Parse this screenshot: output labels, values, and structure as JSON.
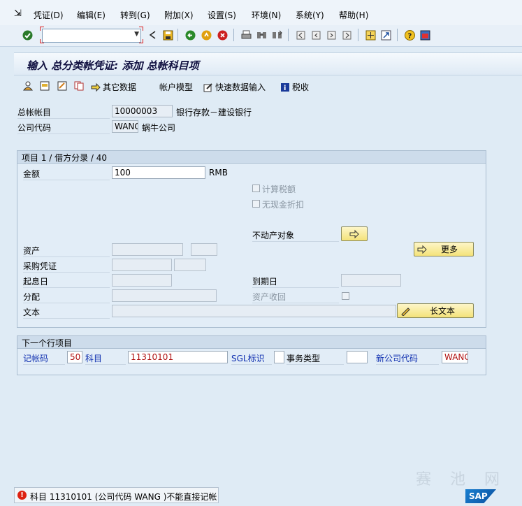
{
  "menu": {
    "items": [
      "凭证(D)",
      "编辑(E)",
      "转到(G)",
      "附加(X)",
      "设置(S)",
      "环境(N)",
      "系统(Y)",
      "帮助(H)"
    ]
  },
  "command_field": {
    "value": ""
  },
  "title": "输入 总分类帐凭证: 添加 总帐科目项",
  "app_toolbar": {
    "other_data": "其它数据",
    "account_model": "帐户模型",
    "fast_entry": "快速数据输入",
    "tax": "税收"
  },
  "header": {
    "gl_account_label": "总帐帐目",
    "gl_account_value": "10000003",
    "gl_account_text": "银行存款－建设银行",
    "company_code_label": "公司代码",
    "company_code_value": "WANG",
    "company_name": "蜗牛公司"
  },
  "item_group": {
    "title": "项目 1 / 借方分录 / 40",
    "amount_label": "金额",
    "amount_value": "100",
    "currency": "RMB",
    "calc_tax_label": "计算税额",
    "no_discount_label": "无现金折扣",
    "real_estate_label": "不动产对象",
    "asset_label": "资产",
    "more_button": "更多",
    "po_label": "采购凭证",
    "value_date_label": "起息日",
    "due_date_label": "到期日",
    "assignment_label": "分配",
    "asset_retirement_label": "资产收回",
    "text_label": "文本",
    "long_text_button": "长文本"
  },
  "next_item": {
    "title": "下一个行项目",
    "posting_key_label": "记帐码",
    "posting_key_value": "50",
    "account_label": "科目",
    "account_value": "11310101",
    "sgl_label": "SGL标识",
    "sgl_value": "",
    "trans_type_label": "事务类型",
    "trans_type_value": "",
    "new_company_label": "新公司代码",
    "new_company_value": "WANG"
  },
  "status_bar": {
    "message": "科目 11310101 (公司代码 WANG )不能直接记帐"
  },
  "logo": "SAP",
  "watermark": "赛 池 网",
  "colors": {
    "background": "#dfebf5",
    "field_label_blue": "#1030b0",
    "field_value_red": "#b01010",
    "button_yellow": "#f4e27a",
    "error_red": "#dd2211"
  }
}
